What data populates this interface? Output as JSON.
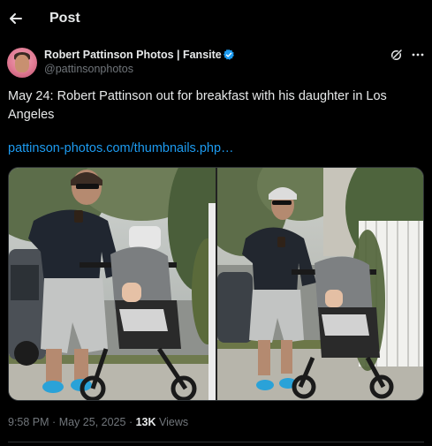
{
  "header": {
    "title": "Post",
    "back_icon": "arrow-left-icon"
  },
  "author": {
    "name": "Robert Pattinson Photos | Fansite",
    "handle": "@pattinsonphotos",
    "verified": true,
    "verified_color": "#1d9bf0"
  },
  "post": {
    "text": "May 24: Robert Pattinson out for breakfast with his daughter in Los Angeles",
    "link": "pattinson-photos.com/thumbnails.php…"
  },
  "meta": {
    "time": "9:58 PM",
    "date": "May 25, 2025",
    "views_count": "13K",
    "views_label": "Views",
    "separator": "·"
  },
  "colors": {
    "background": "#000000",
    "text": "#e7e9ea",
    "secondary": "#71767b",
    "accent": "#1d9bf0"
  }
}
